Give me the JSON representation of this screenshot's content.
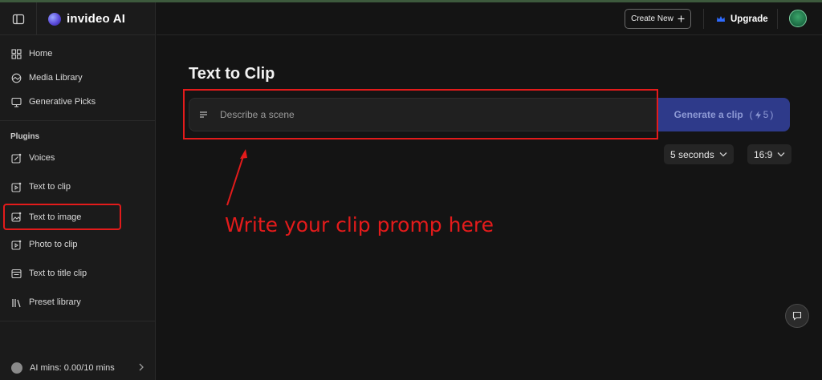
{
  "brand": {
    "name": "invideo AI"
  },
  "sidebar": {
    "top_items": [
      {
        "label": "Home",
        "icon": "grid-icon"
      },
      {
        "label": "Media Library",
        "icon": "media-icon"
      },
      {
        "label": "Generative Picks",
        "icon": "picks-icon"
      }
    ],
    "plugins_label": "Plugins",
    "plugin_items": [
      {
        "label": "Voices",
        "icon": "voices-icon"
      },
      {
        "label": "Text to clip",
        "icon": "text-clip-icon"
      },
      {
        "label": "Text to image",
        "icon": "text-image-icon"
      },
      {
        "label": "Photo to clip",
        "icon": "photo-clip-icon"
      },
      {
        "label": "Text to title clip",
        "icon": "title-clip-icon"
      },
      {
        "label": "Preset library",
        "icon": "preset-icon"
      }
    ],
    "ai_mins": "AI mins: 0.00/10 mins"
  },
  "topbar": {
    "create_new": "Create New",
    "upgrade": "Upgrade"
  },
  "main": {
    "title": "Text to Clip",
    "prompt_placeholder": "Describe a scene",
    "generate_label": "Generate a clip",
    "credit_cost": "5",
    "duration": "5 seconds",
    "aspect_ratio": "16:9"
  },
  "annotation": {
    "text": "Write your clip promp here",
    "color": "#e31b1b"
  },
  "colors": {
    "background": "#141414",
    "sidebar": "#1b1b1b",
    "accent_button": "#2e3a8a",
    "upgrade_crown": "#2f6bff"
  }
}
